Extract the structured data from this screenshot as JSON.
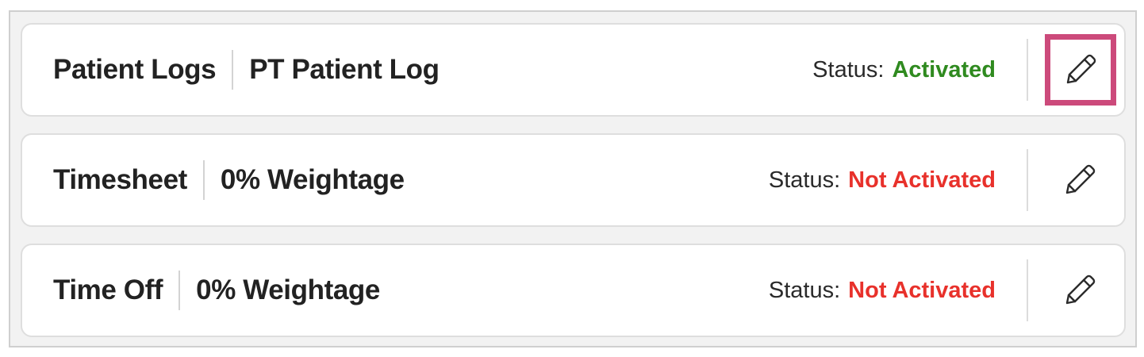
{
  "rows": [
    {
      "name": "Patient Logs",
      "detail": "PT Patient Log",
      "status_label": "Status:",
      "status_value": "Activated",
      "status_color": "#2f8a1f",
      "action_icon": "pencil-icon",
      "highlighted": true
    },
    {
      "name": "Timesheet",
      "detail": "0% Weightage",
      "status_label": "Status:",
      "status_value": "Not Activated",
      "status_color": "#e8312b",
      "action_icon": "pencil-icon",
      "highlighted": false
    },
    {
      "name": "Time Off",
      "detail": "0% Weightage",
      "status_label": "Status:",
      "status_value": "Not Activated",
      "status_color": "#e8312b",
      "action_icon": "pencil-icon",
      "highlighted": false
    }
  ],
  "colors": {
    "highlight_border": "#cc4a7b",
    "activated": "#2f8a1f",
    "not_activated": "#e8312b"
  }
}
